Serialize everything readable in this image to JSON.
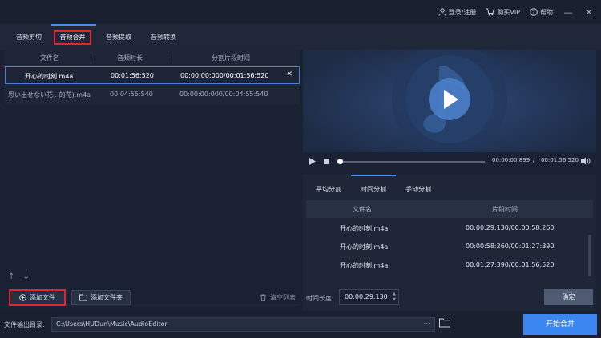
{
  "titlebar": {
    "login_label": "登录/注册",
    "buy_vip_label": "购买VIP",
    "help_label": "帮助",
    "minimize": "—",
    "close": "✕"
  },
  "tabs": [
    {
      "label": "音频剪切"
    },
    {
      "label": "音频合并"
    },
    {
      "label": "音频提取"
    },
    {
      "label": "音频转换"
    }
  ],
  "file_table": {
    "headers": {
      "name": "文件名",
      "duration": "音频时长",
      "segment": "分割片段时间"
    },
    "rows": [
      {
        "name": "开心的时刻.m4a",
        "duration": "00:01:56:520",
        "segment": "00:00:00:000/00:01:56:520",
        "close": "✕"
      },
      {
        "name": "思い出せない花...的花).m4a",
        "duration": "00:04:55:540",
        "segment": "00:00:00:000/00:04:55:540"
      }
    ]
  },
  "left_actions": {
    "up": "↑",
    "down": "↓",
    "add_file": "添加文件",
    "add_folder": "添加文件夹",
    "clear_list": "清空列表"
  },
  "player": {
    "current_time": "00:00:00:899",
    "separator": "/",
    "total_time": "00:01.56.520",
    "progress": 0.01
  },
  "split": {
    "tabs": [
      {
        "label": "平均分割"
      },
      {
        "label": "时间分割"
      },
      {
        "label": "手动分割"
      }
    ],
    "headers": {
      "name": "文件名",
      "segment": "片段时间"
    },
    "rows": [
      {
        "name": "开心的时刻.m4a",
        "segment": "00:00:29:130/00:00:58:260"
      },
      {
        "name": "开心的时刻.m4a",
        "segment": "00:00:58:260/00:01:27:390"
      },
      {
        "name": "开心的时刻.m4a",
        "segment": "00:01:27:390/00:01:56:520"
      }
    ],
    "length_label": "时间长度:",
    "length_value": "00:00:29.130",
    "confirm_label": "确定"
  },
  "bottom": {
    "output_label": "文件输出目录:",
    "output_path": "C:\\Users\\HUDun\\Music\\AudioEditor",
    "dots": "···",
    "start_label": "开始合并"
  }
}
